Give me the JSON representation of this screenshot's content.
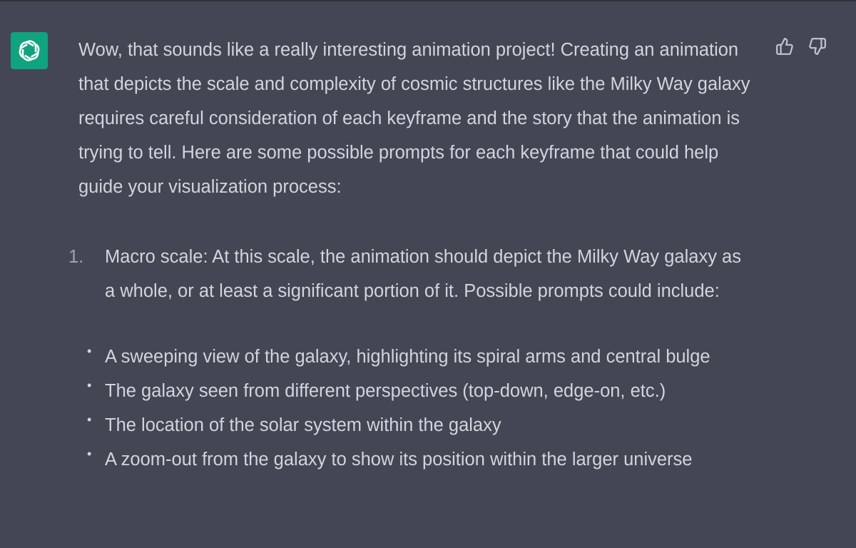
{
  "message": {
    "intro": "Wow, that sounds like a really interesting animation project! Creating an animation that depicts the scale and complexity of cosmic structures like the Milky Way galaxy requires careful consideration of each keyframe and the story that the animation is trying to tell. Here are some possible prompts for each keyframe that could help guide your visualization process:",
    "list": [
      {
        "number": "1.",
        "text": "Macro scale: At this scale, the animation should depict the Milky Way galaxy as a whole, or at least a significant portion of it. Possible prompts could include:"
      }
    ],
    "bullets": [
      "A sweeping view of the galaxy, highlighting its spiral arms and central bulge",
      "The galaxy seen from different perspectives (top-down, edge-on, etc.)",
      "The location of the solar system within the galaxy",
      "A zoom-out from the galaxy to show its position within the larger universe"
    ]
  },
  "icons": {
    "avatar": "openai-logo-icon",
    "like": "thumbs-up-icon",
    "dislike": "thumbs-down-icon"
  },
  "colors": {
    "background": "#444654",
    "avatar_bg": "#10a37f",
    "text": "#d1d5db",
    "muted": "#9ca3af"
  }
}
